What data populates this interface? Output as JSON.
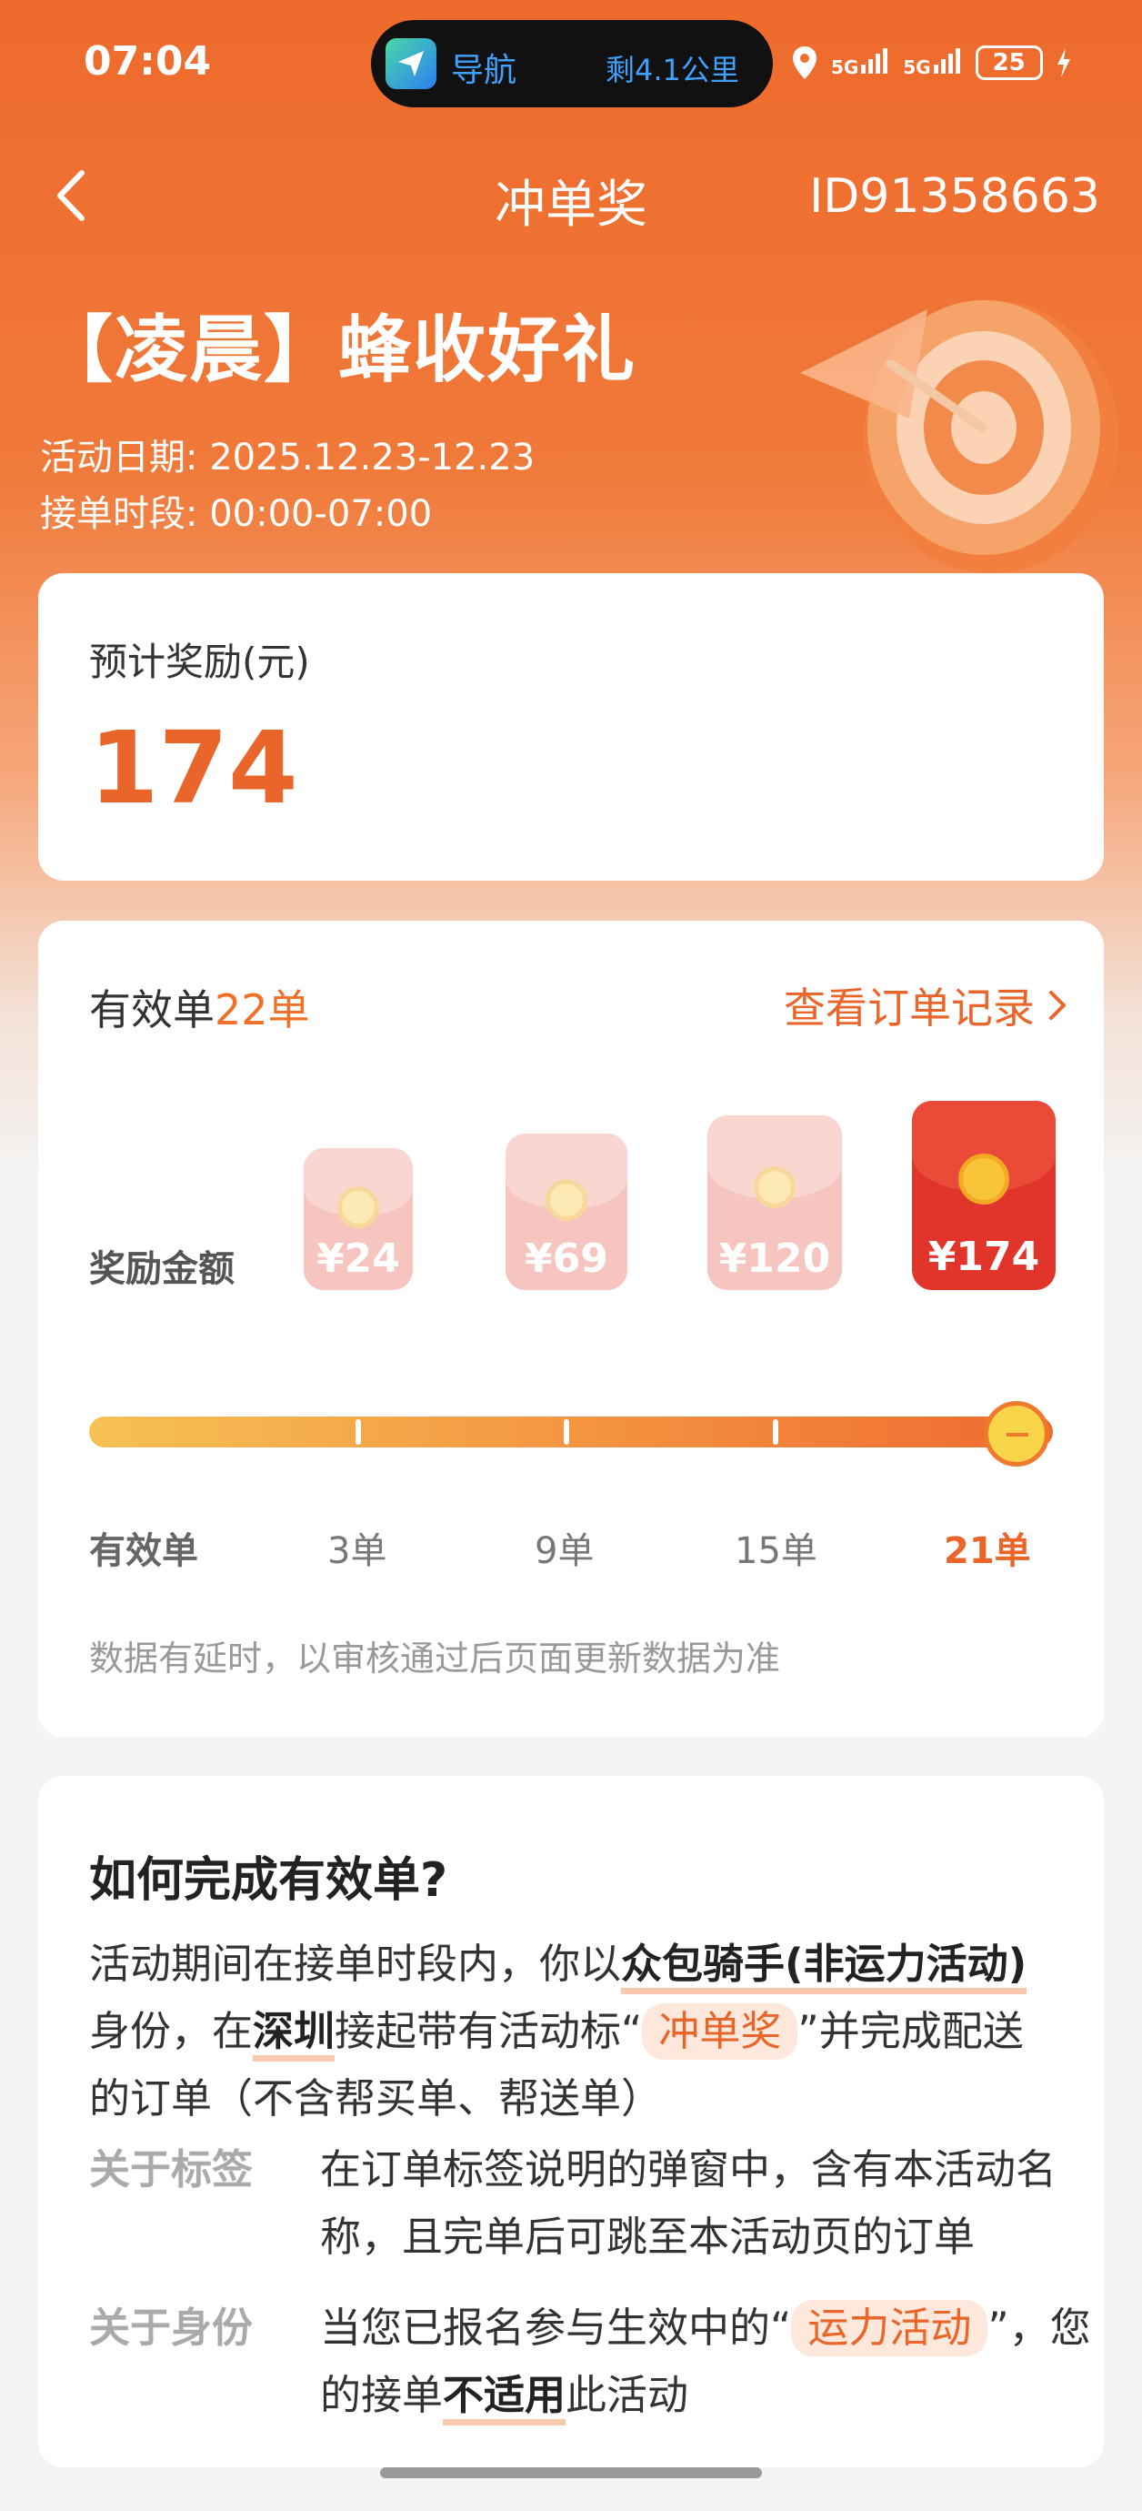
{
  "status_bar": {
    "time": "07:04",
    "nav_app_label": "导航",
    "nav_distance": "剩4.1公里",
    "network_1": "5G",
    "network_2": "5G",
    "battery": "25"
  },
  "header": {
    "title": "冲单奖",
    "id_label": "ID91358663"
  },
  "hero": {
    "title": "【凌晨】蜂收好礼",
    "date_line": "活动日期: 2025.12.23-12.23",
    "time_line": "接单时段: 00:00-07:00"
  },
  "reward": {
    "label": "预计奖励(元)",
    "value": "174"
  },
  "progress": {
    "valid_prefix": "有效单",
    "valid_count": "22单",
    "orders_link": "查看订单记录",
    "reward_row_label": "奖励金额",
    "tiers": [
      {
        "amount": "¥24",
        "orders": "3单"
      },
      {
        "amount": "¥69",
        "orders": "9单"
      },
      {
        "amount": "¥120",
        "orders": "15单"
      },
      {
        "amount": "¥174",
        "orders": "21单"
      }
    ],
    "axis_first_label": "有效单",
    "progress_fraction": 1.0,
    "note": "数据有延时，以审核通过后页面更新数据为准"
  },
  "info": {
    "title": "如何完成有效单?",
    "para_1": "活动期间在接单时段内，你以",
    "para_hl_1": "众包骑手(非运力活动)",
    "para_2": "身份，在",
    "para_hl_2": "深圳",
    "para_3": "接起带有活动标“",
    "para_pill": "冲单奖",
    "para_4": "”并完成配送的订单（不含帮买单、帮送单）",
    "row1_key": "关于标签",
    "row1_value": "在订单标签说明的弹窗中，含有本活动名称，且完单后可跳至本活动页的订单",
    "row2_key": "关于身份",
    "row2_value_1": "当您已报名参与生效中的“",
    "row2_pill": "运力活动",
    "row2_value_2": "”，您的接单",
    "row2_hl": "不适用",
    "row2_value_3": "此活动"
  },
  "colors": {
    "brand_orange": "#e9652a",
    "envelope_active": "#e1342a"
  }
}
